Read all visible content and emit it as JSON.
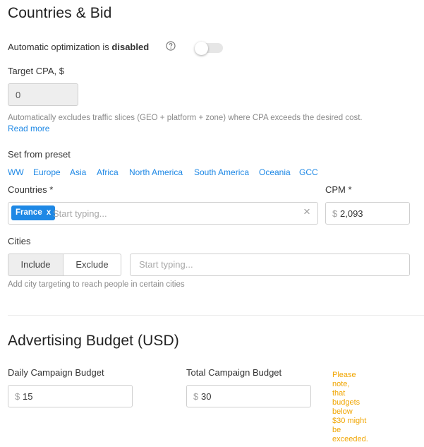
{
  "countries_bid": {
    "title": "Countries & Bid",
    "auto_opt": {
      "label_prefix": "Automatic optimization is ",
      "label_state": "disabled",
      "help_icon": "question-circle-icon",
      "enabled": false
    },
    "target_cpa": {
      "label": "Target CPA, $",
      "value": "0",
      "hint": "Automatically excludes traffic slices (GEO + platform + zone) where CPA exceeds the desired cost.",
      "read_more": "Read more"
    },
    "preset": {
      "label": "Set from preset",
      "items": [
        "WW",
        "Europe",
        "Asia",
        "Africa",
        "North America",
        "South America",
        "Oceania",
        "GCC"
      ]
    },
    "countries": {
      "label": "Countries *",
      "chip": "France",
      "chip_remove": "x",
      "placeholder": "Start typing...",
      "clear_icon": "×"
    },
    "cpm": {
      "label": "CPM *",
      "currency": "$",
      "value": "2,093"
    },
    "cities": {
      "label": "Cities",
      "include": "Include",
      "exclude": "Exclude",
      "placeholder": "Start typing...",
      "hint": "Add city targeting to reach people in certain cities"
    }
  },
  "budget": {
    "title": "Advertising Budget (USD)",
    "daily": {
      "label": "Daily Campaign Budget",
      "currency": "$",
      "value": "15"
    },
    "total": {
      "label": "Total Campaign Budget",
      "currency": "$",
      "value": "30"
    },
    "warning": [
      "Please",
      "note,",
      "that",
      "budgets",
      "below",
      "$30 might",
      "be",
      "exceeded."
    ]
  },
  "colors": {
    "accent": "#1e88e5",
    "warning": "#f0a500",
    "disabled_field": "#eeeeee"
  }
}
